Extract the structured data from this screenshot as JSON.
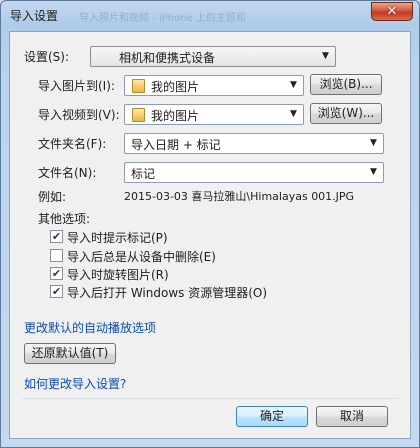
{
  "window": {
    "title": "导入设置",
    "ghost_title": "导入照片和视频 - iPhone 上的主题和 ",
    "close_glyph": "✕"
  },
  "settings": {
    "label": "设置(S):",
    "device_value": "相机和便携式设备"
  },
  "import_pictures": {
    "label": "导入图片到(I):",
    "value": "我的图片",
    "browse": "浏览(B)..."
  },
  "import_videos": {
    "label": "导入视频到(V):",
    "value": "我的图片",
    "browse": "浏览(W)..."
  },
  "folder_name": {
    "label": "文件夹名(F):",
    "value": "导入日期 + 标记"
  },
  "file_name": {
    "label": "文件名(N):",
    "value": "标记"
  },
  "example": {
    "label": "例如:",
    "value": "2015-03-03 喜马拉雅山\\Himalayas 001.JPG"
  },
  "other_options": {
    "label": "其他选项:",
    "items": [
      {
        "label": "导入时提示标记(P)",
        "checked": true
      },
      {
        "label": "导入后总是从设备中删除(E)",
        "checked": false
      },
      {
        "label": "导入时旋转图片(R)",
        "checked": true
      },
      {
        "label": "导入后打开 Windows 资源管理器(O)",
        "checked": true
      }
    ]
  },
  "autoplay_link": "更改默认的自动播放选项",
  "restore_defaults": "还原默认值(T)",
  "help_link": "如何更改导入设置?",
  "ok_label": "确定",
  "cancel_label": "取消",
  "check_glyph": "✔",
  "arrow_glyph": "▼"
}
